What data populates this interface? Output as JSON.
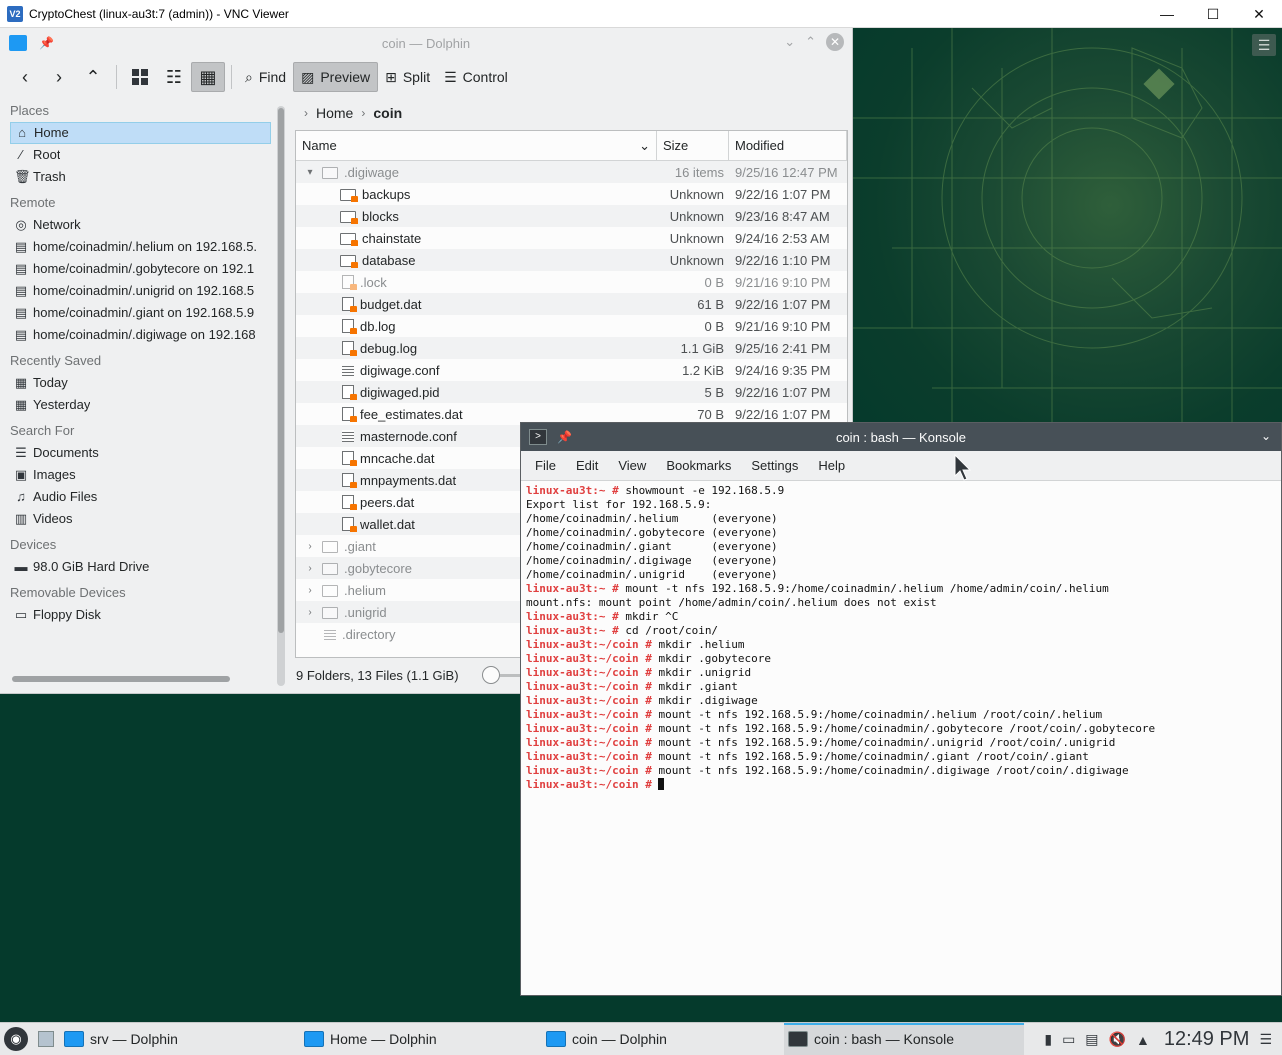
{
  "vnc": {
    "title": "CryptoChest (linux-au3t:7 (admin)) - VNC Viewer",
    "minimize": "—",
    "maximize": "☐",
    "close": "✕"
  },
  "dolphin": {
    "title": "coin — Dolphin",
    "toolbar": {
      "find": "Find",
      "preview": "Preview",
      "split": "Split",
      "control": "Control"
    },
    "places": {
      "sections": [
        {
          "title": "Places",
          "items": [
            {
              "label": "Home",
              "icon": "home-icon",
              "glyph": "⌂",
              "selected": true
            },
            {
              "label": "Root",
              "icon": "root-icon",
              "glyph": "∕"
            },
            {
              "label": "Trash",
              "icon": "trash-icon",
              "glyph": "🗑"
            }
          ]
        },
        {
          "title": "Remote",
          "items": [
            {
              "label": "Network",
              "icon": "network-icon",
              "glyph": "◎"
            },
            {
              "label": "home/coinadmin/.helium on 192.168.5.",
              "icon": "nfs-share-icon",
              "glyph": "▤"
            },
            {
              "label": "home/coinadmin/.gobytecore on 192.1",
              "icon": "nfs-share-icon",
              "glyph": "▤"
            },
            {
              "label": "home/coinadmin/.unigrid on 192.168.5",
              "icon": "nfs-share-icon",
              "glyph": "▤"
            },
            {
              "label": "home/coinadmin/.giant on 192.168.5.9",
              "icon": "nfs-share-icon",
              "glyph": "▤"
            },
            {
              "label": "home/coinadmin/.digiwage on 192.168",
              "icon": "nfs-share-icon",
              "glyph": "▤"
            }
          ]
        },
        {
          "title": "Recently Saved",
          "items": [
            {
              "label": "Today",
              "icon": "calendar-icon",
              "glyph": "▦"
            },
            {
              "label": "Yesterday",
              "icon": "calendar-icon",
              "glyph": "▦"
            }
          ]
        },
        {
          "title": "Search For",
          "items": [
            {
              "label": "Documents",
              "icon": "documents-icon",
              "glyph": "☰"
            },
            {
              "label": "Images",
              "icon": "images-icon",
              "glyph": "▣"
            },
            {
              "label": "Audio Files",
              "icon": "audio-icon",
              "glyph": "♫"
            },
            {
              "label": "Videos",
              "icon": "videos-icon",
              "glyph": "▥"
            }
          ]
        },
        {
          "title": "Devices",
          "items": [
            {
              "label": "98.0 GiB Hard Drive",
              "icon": "hard-drive-icon",
              "glyph": "▬"
            }
          ]
        },
        {
          "title": "Removable Devices",
          "items": [
            {
              "label": "Floppy Disk",
              "icon": "floppy-icon",
              "glyph": "▭"
            }
          ]
        }
      ]
    },
    "breadcrumb": {
      "home": "Home",
      "current": "coin"
    },
    "columns": {
      "name": "Name",
      "size": "Size",
      "modified": "Modified"
    },
    "files": [
      {
        "name": ".digiwage",
        "size": "16 items",
        "modified": "9/25/16 12:47 PM",
        "type": "folder",
        "level": 0,
        "expander": "▾",
        "hidden": true
      },
      {
        "name": "backups",
        "size": "Unknown",
        "modified": "9/22/16 1:07 PM",
        "type": "folder-lock",
        "level": 1
      },
      {
        "name": "blocks",
        "size": "Unknown",
        "modified": "9/23/16 8:47 AM",
        "type": "folder-lock",
        "level": 1
      },
      {
        "name": "chainstate",
        "size": "Unknown",
        "modified": "9/24/16 2:53 AM",
        "type": "folder-lock",
        "level": 1
      },
      {
        "name": "database",
        "size": "Unknown",
        "modified": "9/22/16 1:10 PM",
        "type": "folder-lock",
        "level": 1
      },
      {
        "name": ".lock",
        "size": "0 B",
        "modified": "9/21/16 9:10 PM",
        "type": "file-lock",
        "level": 1,
        "hidden": true
      },
      {
        "name": "budget.dat",
        "size": "61 B",
        "modified": "9/22/16 1:07 PM",
        "type": "file-lock",
        "level": 1
      },
      {
        "name": "db.log",
        "size": "0 B",
        "modified": "9/21/16 9:10 PM",
        "type": "file-lock",
        "level": 1
      },
      {
        "name": "debug.log",
        "size": "1.1 GiB",
        "modified": "9/25/16 2:41 PM",
        "type": "file-lock",
        "level": 1
      },
      {
        "name": "digiwage.conf",
        "size": "1.2 KiB",
        "modified": "9/24/16 9:35 PM",
        "type": "text",
        "level": 1
      },
      {
        "name": "digiwaged.pid",
        "size": "5 B",
        "modified": "9/22/16 1:07 PM",
        "type": "file-lock",
        "level": 1
      },
      {
        "name": "fee_estimates.dat",
        "size": "70 B",
        "modified": "9/22/16 1:07 PM",
        "type": "file-lock",
        "level": 1
      },
      {
        "name": "masternode.conf",
        "size": "",
        "modified": "",
        "type": "text",
        "level": 1
      },
      {
        "name": "mncache.dat",
        "size": "",
        "modified": "",
        "type": "file-lock",
        "level": 1
      },
      {
        "name": "mnpayments.dat",
        "size": "",
        "modified": "",
        "type": "file-lock",
        "level": 1
      },
      {
        "name": "peers.dat",
        "size": "",
        "modified": "",
        "type": "file-lock",
        "level": 1
      },
      {
        "name": "wallet.dat",
        "size": "",
        "modified": "",
        "type": "file-lock",
        "level": 1
      },
      {
        "name": ".giant",
        "size": "",
        "modified": "",
        "type": "folder",
        "level": 0,
        "expander": "›",
        "hidden": true
      },
      {
        "name": ".gobytecore",
        "size": "",
        "modified": "",
        "type": "folder",
        "level": 0,
        "expander": "›",
        "hidden": true
      },
      {
        "name": ".helium",
        "size": "",
        "modified": "",
        "type": "folder",
        "level": 0,
        "expander": "›",
        "hidden": true
      },
      {
        "name": ".unigrid",
        "size": "",
        "modified": "",
        "type": "folder",
        "level": 0,
        "expander": "›",
        "hidden": true
      },
      {
        "name": ".directory",
        "size": "",
        "modified": "",
        "type": "text",
        "level": 0,
        "expander": "",
        "hidden": true
      }
    ],
    "status": "9 Folders, 13 Files (1.1 GiB)"
  },
  "konsole": {
    "title": "coin : bash — Konsole",
    "menu": [
      "File",
      "Edit",
      "View",
      "Bookmarks",
      "Settings",
      "Help"
    ],
    "lines": [
      {
        "prompt": "linux-au3t:~ # ",
        "text": "showmount -e 192.168.5.9"
      },
      {
        "prompt": "",
        "text": "Export list for 192.168.5.9:"
      },
      {
        "prompt": "",
        "text": "/home/coinadmin/.helium     (everyone)"
      },
      {
        "prompt": "",
        "text": "/home/coinadmin/.gobytecore (everyone)"
      },
      {
        "prompt": "",
        "text": "/home/coinadmin/.giant      (everyone)"
      },
      {
        "prompt": "",
        "text": "/home/coinadmin/.digiwage   (everyone)"
      },
      {
        "prompt": "",
        "text": "/home/coinadmin/.unigrid    (everyone)"
      },
      {
        "prompt": "linux-au3t:~ # ",
        "text": "mount -t nfs 192.168.5.9:/home/coinadmin/.helium /home/admin/coin/.helium"
      },
      {
        "prompt": "",
        "text": "mount.nfs: mount point /home/admin/coin/.helium does not exist"
      },
      {
        "prompt": "linux-au3t:~ # ",
        "text": "mkdir ^C"
      },
      {
        "prompt": "linux-au3t:~ # ",
        "text": "cd /root/coin/"
      },
      {
        "prompt": "linux-au3t:~/coin # ",
        "text": "mkdir .helium"
      },
      {
        "prompt": "linux-au3t:~/coin # ",
        "text": "mkdir .gobytecore"
      },
      {
        "prompt": "linux-au3t:~/coin # ",
        "text": "mkdir .unigrid"
      },
      {
        "prompt": "linux-au3t:~/coin # ",
        "text": "mkdir .giant"
      },
      {
        "prompt": "linux-au3t:~/coin # ",
        "text": "mkdir .digiwage"
      },
      {
        "prompt": "linux-au3t:~/coin # ",
        "text": "mount -t nfs 192.168.5.9:/home/coinadmin/.helium /root/coin/.helium"
      },
      {
        "prompt": "linux-au3t:~/coin # ",
        "text": "mount -t nfs 192.168.5.9:/home/coinadmin/.gobytecore /root/coin/.gobytecore"
      },
      {
        "prompt": "linux-au3t:~/coin # ",
        "text": "mount -t nfs 192.168.5.9:/home/coinadmin/.unigrid /root/coin/.unigrid"
      },
      {
        "prompt": "linux-au3t:~/coin # ",
        "text": "mount -t nfs 192.168.5.9:/home/coinadmin/.giant /root/coin/.giant"
      },
      {
        "prompt": "linux-au3t:~/coin # ",
        "text": "mount -t nfs 192.168.5.9:/home/coinadmin/.digiwage /root/coin/.digiwage"
      },
      {
        "prompt": "linux-au3t:~/coin # ",
        "text": "",
        "cursor": true
      }
    ]
  },
  "taskbar": {
    "tasks": [
      {
        "label": "srv — Dolphin",
        "icon": "dolphin-icon"
      },
      {
        "label": "Home — Dolphin",
        "icon": "dolphin-icon"
      },
      {
        "label": "coin — Dolphin",
        "icon": "dolphin-icon"
      },
      {
        "label": "coin : bash — Konsole",
        "icon": "konsole-icon",
        "active": true
      }
    ],
    "clock": "12:49 PM"
  },
  "colors": {
    "accent": "#3daee9",
    "desktop": "#053a2c",
    "prompt": "#e04040",
    "selection": "#bfddf7"
  }
}
